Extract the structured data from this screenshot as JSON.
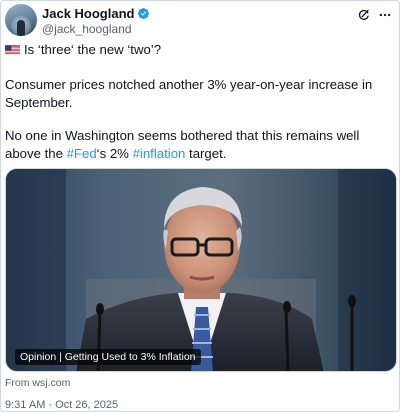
{
  "author": {
    "name": "Jack Hoogland",
    "handle": "@jack_hoogland",
    "verified": true
  },
  "tweet": {
    "line1": "Is ‘three‘ the new ‘two’?",
    "flag": "flag-us-icon",
    "paragraph2": "Consumer prices notched another 3% year-on-year increase in September.",
    "p3_part1": "No one in Washington seems bothered that this remains well above the ",
    "hashtag1": "#Fed",
    "p3_part2": "‘s 2% ",
    "hashtag2": "#inflation",
    "p3_part3": " target."
  },
  "media": {
    "caption": "Opinion | Getting Used to 3% Inflation",
    "source": "From wsj.com"
  },
  "timestamp": "9:31 AM · Oct 26, 2025",
  "colors": {
    "accent": "#1d9bf0",
    "text": "#0f1419",
    "muted": "#536471"
  }
}
